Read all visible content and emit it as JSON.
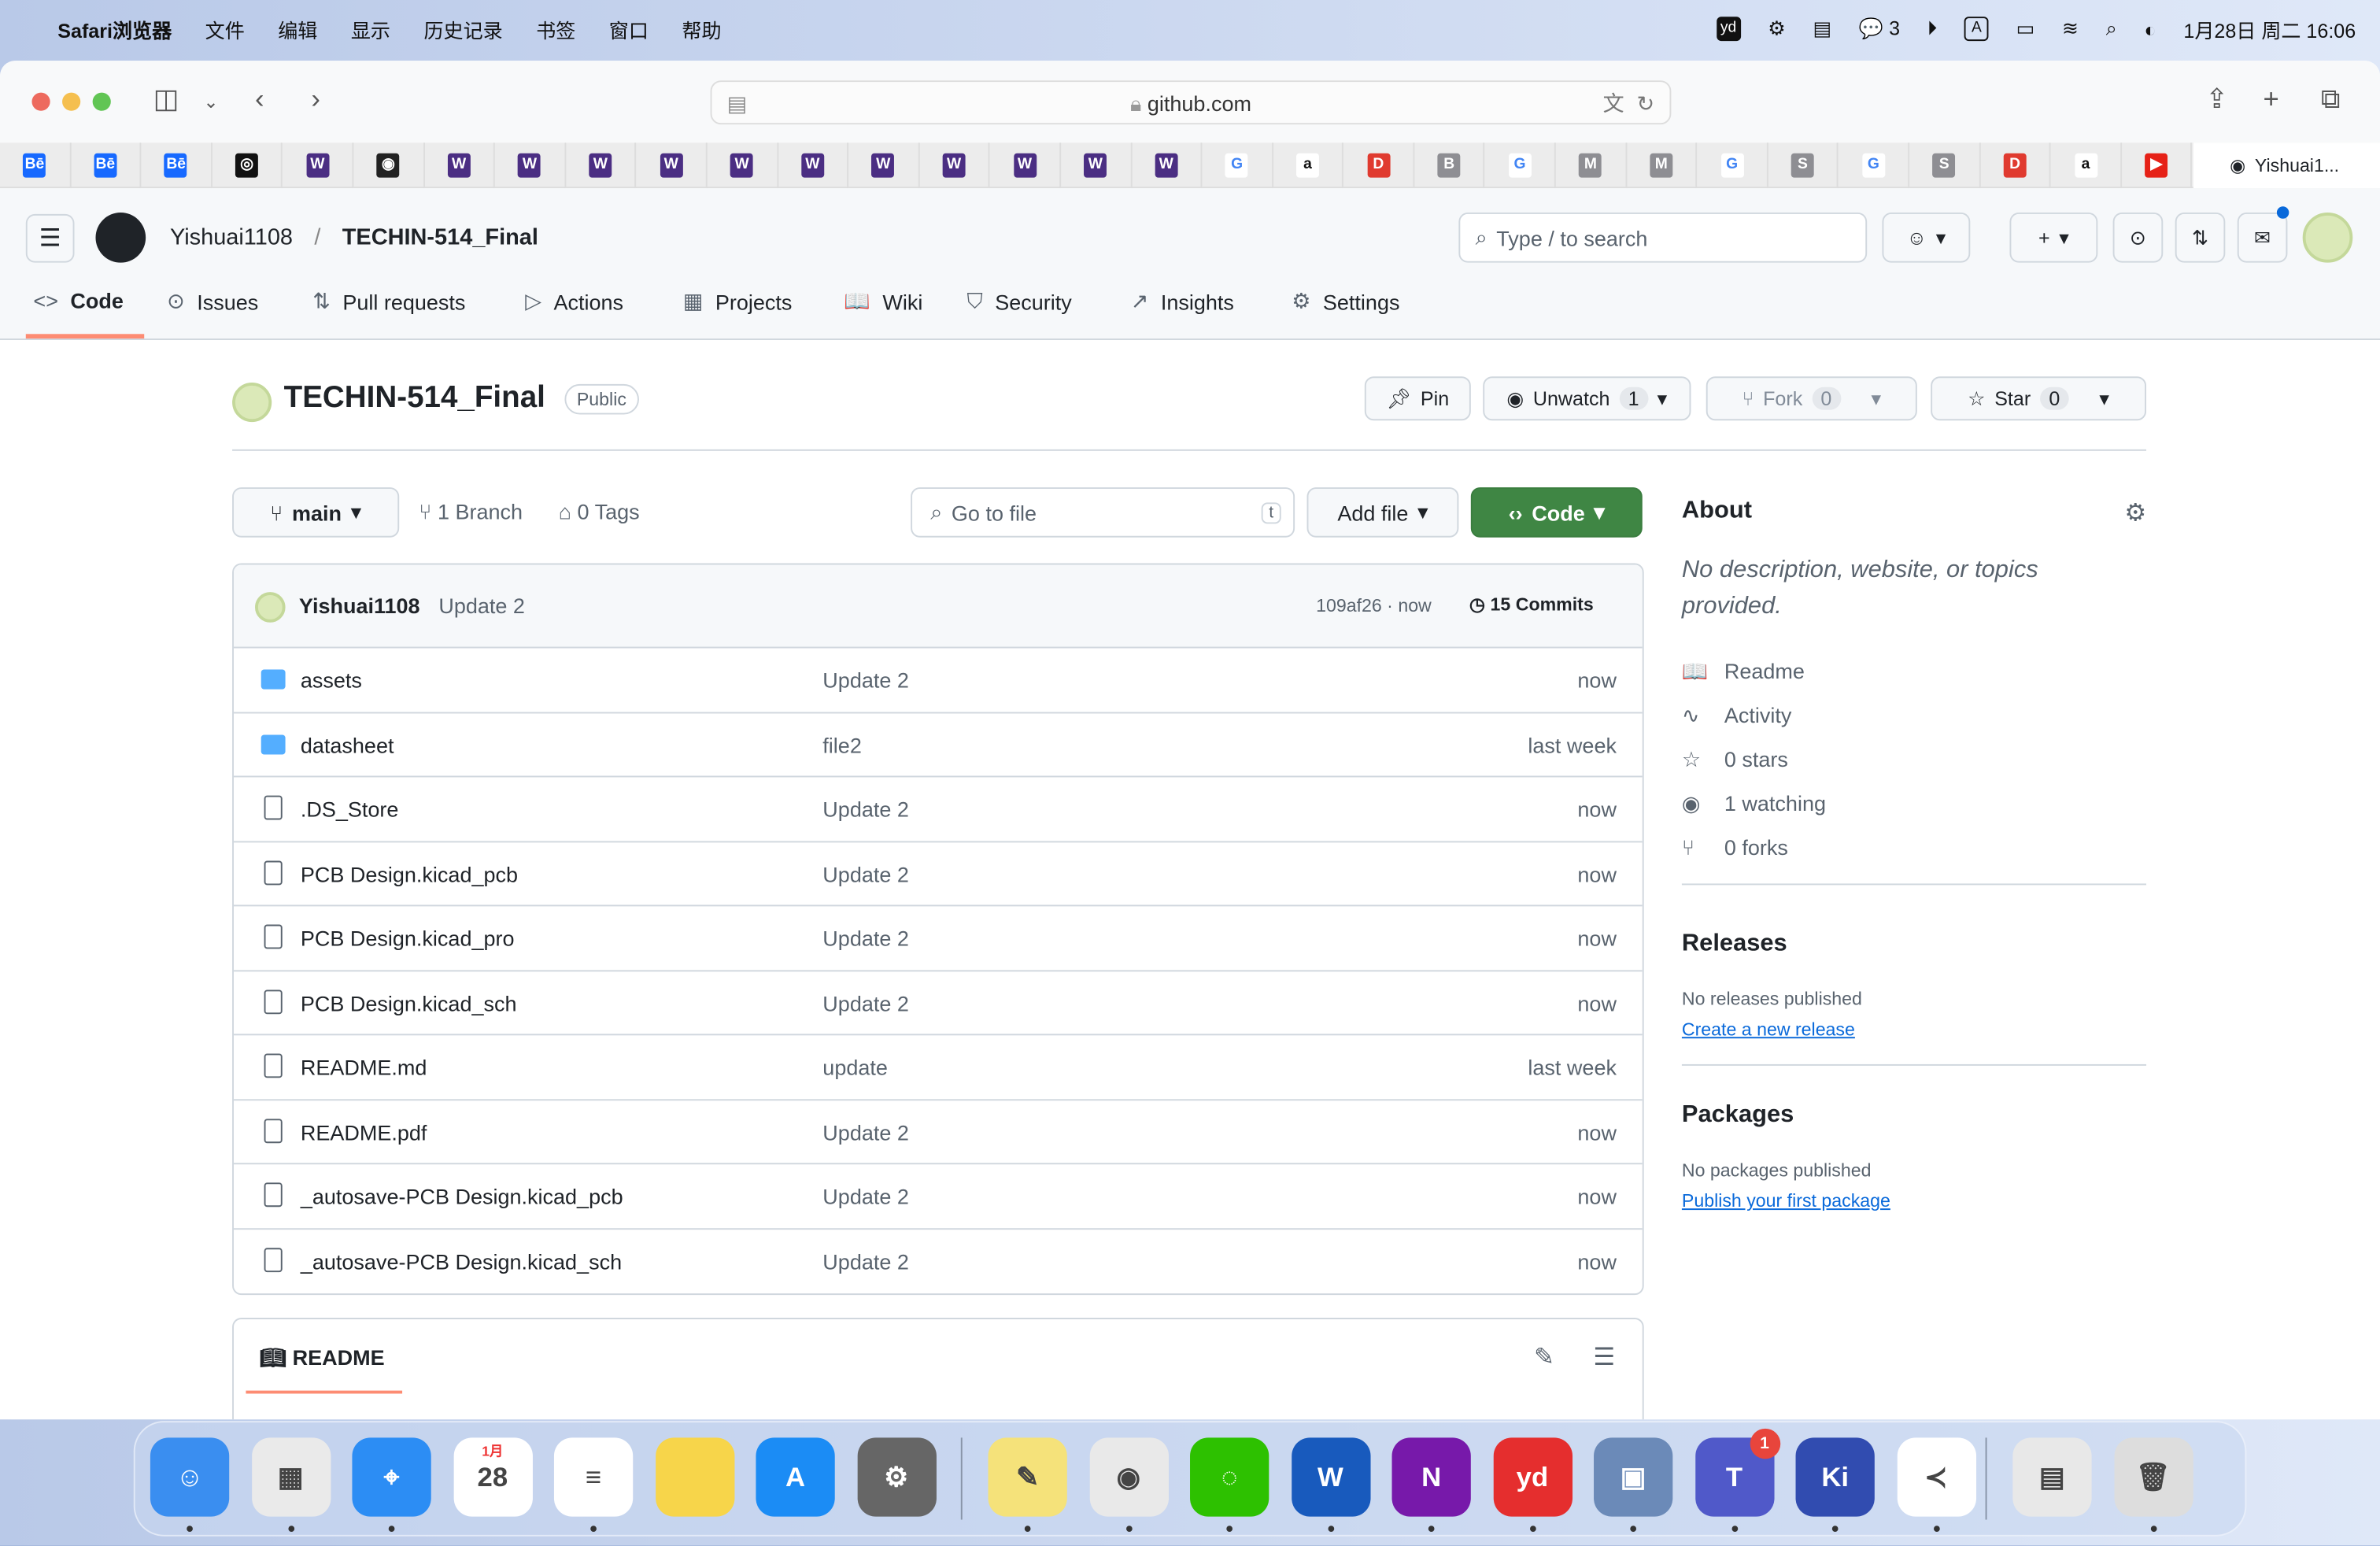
{
  "menubar": {
    "app": "Safari浏览器",
    "items": [
      "文件",
      "编辑",
      "显示",
      "历史记录",
      "书签",
      "窗口",
      "帮助"
    ],
    "wechat_count": "3",
    "input": "A",
    "clock": "1月28日 周二 16:06"
  },
  "browser": {
    "url": "github.com",
    "bookmarks": [
      {
        "t": "Bē",
        "c": "#1769ff"
      },
      {
        "t": "Bē",
        "c": "#1769ff"
      },
      {
        "t": "Bē",
        "c": "#1769ff"
      },
      {
        "t": "◎",
        "c": "#111"
      },
      {
        "t": "W",
        "c": "#4b2e83"
      },
      {
        "t": "◉",
        "c": "#222"
      },
      {
        "t": "W",
        "c": "#4b2e83"
      },
      {
        "t": "W",
        "c": "#4b2e83"
      },
      {
        "t": "W",
        "c": "#4b2e83"
      },
      {
        "t": "W",
        "c": "#4b2e83"
      },
      {
        "t": "W",
        "c": "#4b2e83"
      },
      {
        "t": "W",
        "c": "#4b2e83"
      },
      {
        "t": "W",
        "c": "#4b2e83"
      },
      {
        "t": "W",
        "c": "#4b2e83"
      },
      {
        "t": "W",
        "c": "#4b2e83"
      },
      {
        "t": "W",
        "c": "#4b2e83"
      },
      {
        "t": "W",
        "c": "#4b2e83"
      },
      {
        "t": "G",
        "c": "#4285f4"
      },
      {
        "t": "a",
        "c": "#111"
      },
      {
        "t": "D",
        "c": "#e03a2f"
      },
      {
        "t": "B",
        "c": "#8e8e93"
      },
      {
        "t": "G",
        "c": "#4285f4"
      },
      {
        "t": "M",
        "c": "#8e8e93"
      },
      {
        "t": "M",
        "c": "#8e8e93"
      },
      {
        "t": "G",
        "c": "#4285f4"
      },
      {
        "t": "S",
        "c": "#8e8e93"
      },
      {
        "t": "G",
        "c": "#4285f4"
      },
      {
        "t": "S",
        "c": "#8e8e93"
      },
      {
        "t": "D",
        "c": "#e03a2f"
      },
      {
        "t": "a",
        "c": "#111"
      },
      {
        "t": "▶",
        "c": "#e62117"
      }
    ],
    "tab_label": "Yishuai1..."
  },
  "github": {
    "owner": "Yishuai1108",
    "repo": "TECHIN-514_Final",
    "search": "Type / to search",
    "search_key": "/",
    "nav": [
      {
        "icon": "<>",
        "label": "Code"
      },
      {
        "icon": "⊙",
        "label": "Issues"
      },
      {
        "icon": "⇅",
        "label": "Pull requests"
      },
      {
        "icon": "▷",
        "label": "Actions"
      },
      {
        "icon": "▦",
        "label": "Projects"
      },
      {
        "icon": "📖",
        "label": "Wiki"
      },
      {
        "icon": "⛉",
        "label": "Security"
      },
      {
        "icon": "↗",
        "label": "Insights"
      },
      {
        "icon": "⚙",
        "label": "Settings"
      }
    ],
    "visibility": "Public",
    "pin": "Pin",
    "unwatch": "Unwatch",
    "watch_count": "1",
    "fork": "Fork",
    "fork_count": "0",
    "star": "Star",
    "star_count": "0",
    "branch": "main",
    "branches": "1 Branch",
    "tags": "0 Tags",
    "go_to_file": "Go to file",
    "go_key": "t",
    "add_file": "Add file",
    "code_btn": "Code",
    "commit": {
      "author": "Yishuai1108",
      "message": "Update 2",
      "hash": "109af26 · now",
      "count": "15 Commits"
    },
    "files": [
      {
        "type": "dir",
        "name": "assets",
        "msg": "Update 2",
        "time": "now"
      },
      {
        "type": "dir",
        "name": "datasheet",
        "msg": "file2",
        "time": "last week"
      },
      {
        "type": "file",
        "name": ".DS_Store",
        "msg": "Update 2",
        "time": "now"
      },
      {
        "type": "file",
        "name": "PCB Design.kicad_pcb",
        "msg": "Update 2",
        "time": "now"
      },
      {
        "type": "file",
        "name": "PCB Design.kicad_pro",
        "msg": "Update 2",
        "time": "now"
      },
      {
        "type": "file",
        "name": "PCB Design.kicad_sch",
        "msg": "Update 2",
        "time": "now"
      },
      {
        "type": "file",
        "name": "README.md",
        "msg": "update",
        "time": "last week"
      },
      {
        "type": "file",
        "name": "README.pdf",
        "msg": "Update 2",
        "time": "now"
      },
      {
        "type": "file",
        "name": "_autosave-PCB Design.kicad_pcb",
        "msg": "Update 2",
        "time": "now"
      },
      {
        "type": "file",
        "name": "_autosave-PCB Design.kicad_sch",
        "msg": "Update 2",
        "time": "now"
      }
    ],
    "readme": "README",
    "about": {
      "title": "About",
      "desc": "No description, website, or topics provided.",
      "items": [
        {
          "icon": "📖",
          "label": "Readme"
        },
        {
          "icon": "∿",
          "label": "Activity"
        },
        {
          "icon": "☆",
          "label": "0 stars"
        },
        {
          "icon": "◉",
          "label": "1 watching"
        },
        {
          "icon": "⑂",
          "label": "0 forks"
        }
      ]
    },
    "releases": {
      "title": "Releases",
      "text": "No releases published",
      "link": "Create a new release"
    },
    "packages": {
      "title": "Packages",
      "text": "No packages published",
      "link": "Publish your first package"
    }
  },
  "dock": [
    {
      "t": "☺",
      "c": "#3a8ef0",
      "n": "finder"
    },
    {
      "t": "▦",
      "c": "#eaeaea",
      "n": "launchpad"
    },
    {
      "t": "⌖",
      "c": "#2c8df4",
      "n": "safari"
    },
    {
      "t": "28",
      "c": "#fff",
      "n": "calendar",
      "sub": "1月"
    },
    {
      "t": "≡",
      "c": "#fff",
      "n": "reminders"
    },
    {
      "t": "",
      "c": "#f7d54a",
      "n": "notes"
    },
    {
      "t": "A",
      "c": "#1b8cf5",
      "n": "app-store"
    },
    {
      "t": "⚙",
      "c": "#666",
      "n": "system-settings"
    },
    {
      "t": "✎",
      "c": "#f5e27a",
      "n": "stickies"
    },
    {
      "t": "◉",
      "c": "#e9e9e9",
      "n": "chrome"
    },
    {
      "t": "◌",
      "c": "#2dc100",
      "n": "wechat"
    },
    {
      "t": "W",
      "c": "#185abd",
      "n": "word"
    },
    {
      "t": "N",
      "c": "#7719aa",
      "n": "onenote"
    },
    {
      "t": "yd",
      "c": "#e52e2e",
      "n": "youdao"
    },
    {
      "t": "▣",
      "c": "#6b8ab8",
      "n": "preview"
    },
    {
      "t": "T",
      "c": "#5059c9",
      "n": "teams",
      "badge": "1"
    },
    {
      "t": "Ki",
      "c": "#314cb0",
      "n": "kicad"
    },
    {
      "t": "≺",
      "c": "#fff",
      "n": "vscode"
    },
    {
      "t": "▤",
      "c": "#e8e8e8",
      "n": "documents"
    },
    {
      "t": "🗑",
      "c": "#ddd",
      "n": "trash"
    }
  ]
}
